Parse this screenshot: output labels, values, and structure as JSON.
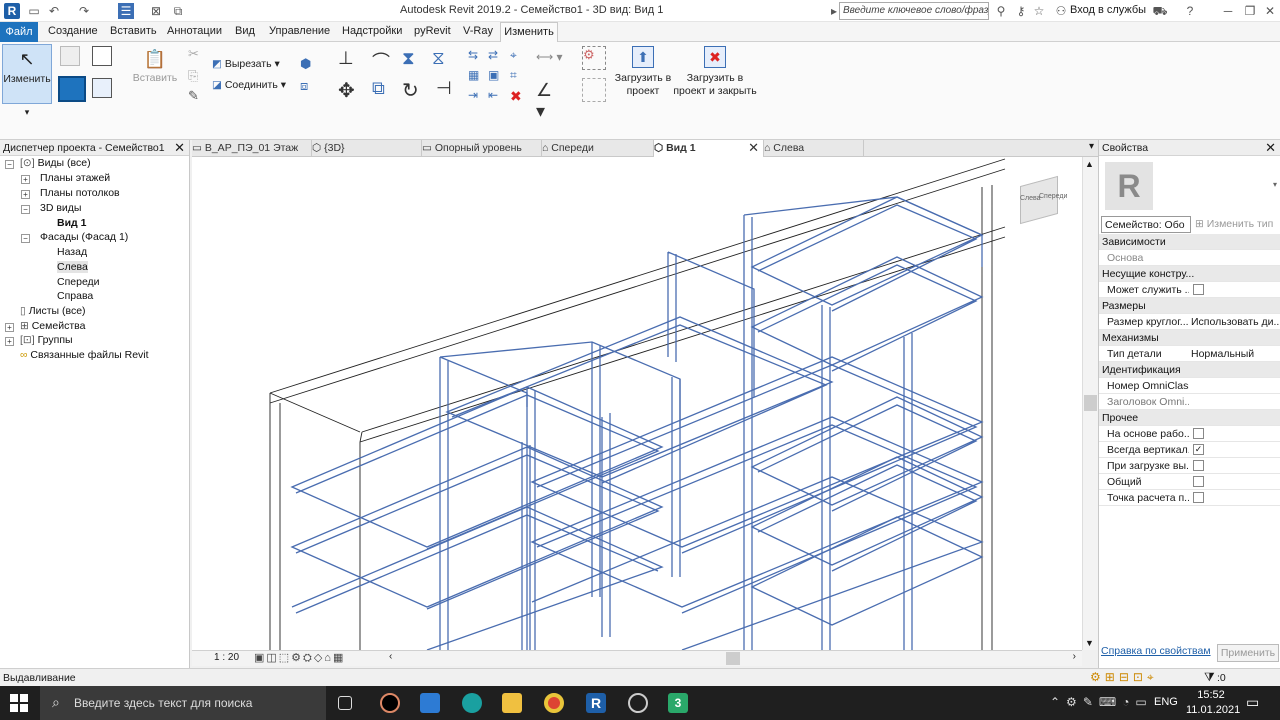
{
  "title_bar": {
    "title": "Autodesk Revit 2019.2 - Семейство1 - 3D вид: Вид 1",
    "search_placeholder": "Введите ключевое слово/фразу",
    "signin": "Вход в службы"
  },
  "menu": {
    "file": "Файл",
    "tabs": [
      "Создание",
      "Вставить",
      "Аннотации",
      "Вид",
      "Управление",
      "Надстройки",
      "pyRevit",
      "V-Ray",
      "Изменить"
    ]
  },
  "ribbon": {
    "modify": "Изменить",
    "paste": "Вставить",
    "cut": "Вырезать",
    "join": "Соединить",
    "load_project": "Загрузить в\nпроект",
    "load_close": "Загрузить в\nпроект и закрыть"
  },
  "project_browser": {
    "title": "Диспетчер проекта - Семейство1",
    "nodes": [
      {
        "label": "Виды (все)"
      },
      {
        "label": "Планы этажей"
      },
      {
        "label": "Планы потолков"
      },
      {
        "label": "3D виды"
      },
      {
        "label": "Вид 1"
      },
      {
        "label": "Фасады (Фасад 1)"
      },
      {
        "label": "Назад"
      },
      {
        "label": "Слева"
      },
      {
        "label": "Спереди"
      },
      {
        "label": "Справа"
      },
      {
        "label": "Листы (все)"
      },
      {
        "label": "Семейства"
      },
      {
        "label": "Группы"
      },
      {
        "label": "Связанные файлы Revit"
      }
    ]
  },
  "view_tabs": [
    "В_АР_ПЭ_01 Этаж",
    "{3D}",
    "Опорный уровень",
    "Спереди",
    "Вид 1",
    "Слева"
  ],
  "viewcube": {
    "left": "Слева",
    "front": "Спереди"
  },
  "view_bar": {
    "scale": "1 : 20"
  },
  "properties": {
    "title": "Свойства",
    "family_selector": "Семейство: Обо",
    "edit_type": "Изменить тип",
    "rows": [
      {
        "group": "Зависимости"
      },
      {
        "key": "Основа",
        "value": ""
      },
      {
        "group": "Несущие констру..."
      },
      {
        "key": "Может служить ...",
        "check": false
      },
      {
        "group": "Размеры"
      },
      {
        "key": "Размер круглог...",
        "value": "Использовать ди..."
      },
      {
        "group": "Механизмы"
      },
      {
        "key": "Тип детали",
        "value": "Нормальный"
      },
      {
        "group": "Идентификация"
      },
      {
        "key": "Номер OmniClass",
        "value": ""
      },
      {
        "key": "Заголовок Omni...",
        "value": ""
      },
      {
        "group": "Прочее"
      },
      {
        "key": "На основе рабо...",
        "check": false
      },
      {
        "key": "Всегда вертикал...",
        "check": true
      },
      {
        "key": "При загрузке вы...",
        "check": false
      },
      {
        "key": "Общий",
        "check": false
      },
      {
        "key": "Точка расчета п...",
        "check": false
      }
    ],
    "help_link": "Справка по свойствам",
    "apply": "Применить"
  },
  "status": {
    "text": "Выдавливание",
    "filter_count": ":0"
  },
  "taskbar": {
    "search_placeholder": "Введите здесь текст для поиска",
    "lang": "ENG",
    "time": "15:52",
    "date": "11.01.2021"
  },
  "colors": {
    "accent": "#1e73be",
    "model_lines": "#4a6db0"
  }
}
